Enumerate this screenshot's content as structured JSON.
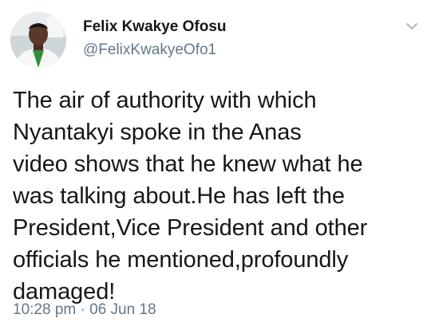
{
  "tweet": {
    "author": {
      "name": "Felix Kwakye Ofosu",
      "handle": "@FelixKwakyeOfo1",
      "avatar_icon": "profile-photo"
    },
    "text": "The air of authority with which\nNyantakyi spoke  in the Anas\nvideo shows that he knew what he\nwas talking about.He has left the\nPresident,Vice President and other\nofficials he mentioned,profoundly\ndamaged!",
    "time": "10:28 pm",
    "separator": "·",
    "date": "06 Jun 18",
    "menu_icon": "chevron-down-icon"
  },
  "colors": {
    "name": "#14171a",
    "secondary": "#657786",
    "chevron": "#aab8c2",
    "background": "#ffffff"
  }
}
